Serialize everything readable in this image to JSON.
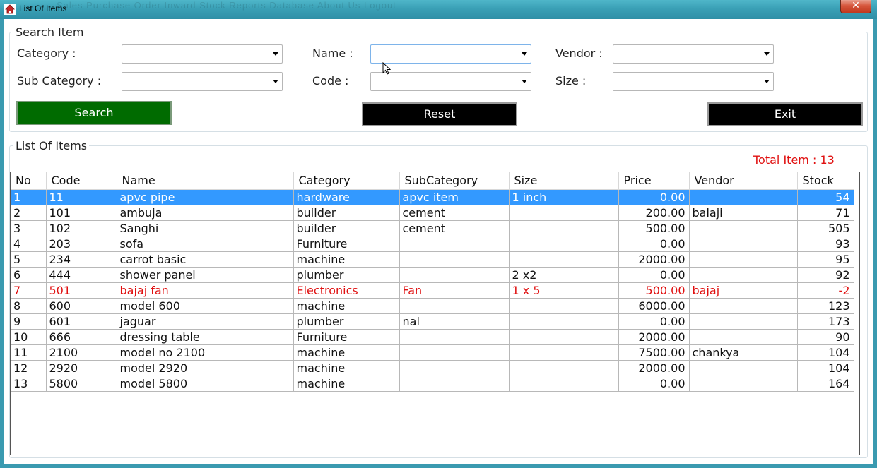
{
  "window": {
    "title": "List Of Items",
    "close_label": "✕",
    "background_menu": "Sales    Purchase Order    Inward Stock    Reports    Database    About Us    Logout"
  },
  "search": {
    "legend": "Search Item",
    "category_label": "Category :",
    "sub_category_label": "Sub Category :",
    "name_label": "Name :",
    "code_label": "Code :",
    "vendor_label": "Vendor :",
    "size_label": "Size :",
    "category_value": "",
    "sub_category_value": "",
    "name_value": "",
    "code_value": "",
    "vendor_value": "",
    "size_value": "",
    "search_button": "Search",
    "reset_button": "Reset",
    "exit_button": "Exit"
  },
  "list": {
    "legend": "List Of Items",
    "total_label": "Total Item : 13"
  },
  "table": {
    "columns": [
      "No",
      "Code",
      "Name",
      "Category",
      "SubCategory",
      "Size",
      "Price",
      "Vendor",
      "Stock"
    ],
    "rows": [
      [
        "1",
        "11",
        "apvc pipe",
        "hardware",
        "apvc item",
        "1 inch",
        "0.00",
        "",
        "54"
      ],
      [
        "2",
        "101",
        "ambuja",
        "builder",
        "cement",
        "",
        "200.00",
        "balaji",
        "71"
      ],
      [
        "3",
        "102",
        "Sanghi",
        "builder",
        "cement",
        "",
        "500.00",
        "",
        "505"
      ],
      [
        "4",
        "203",
        "sofa",
        "Furniture",
        "",
        "",
        "0.00",
        "",
        "93"
      ],
      [
        "5",
        "234",
        "carrot basic",
        "machine",
        "",
        "",
        "2000.00",
        "",
        "95"
      ],
      [
        "6",
        "444",
        "shower panel",
        "plumber",
        "",
        "2 x2",
        "0.00",
        "",
        "92"
      ],
      [
        "7",
        "501",
        "bajaj fan",
        "Electronics",
        "Fan",
        "1 x 5",
        "500.00",
        "bajaj",
        "-2"
      ],
      [
        "8",
        "600",
        "model 600",
        "machine",
        "",
        "",
        "6000.00",
        "",
        "123"
      ],
      [
        "9",
        "601",
        "jaguar",
        "plumber",
        "nal",
        "",
        "0.00",
        "",
        "173"
      ],
      [
        "10",
        "666",
        "dressing table",
        "Furniture",
        "",
        "",
        "2000.00",
        "",
        "90"
      ],
      [
        "11",
        "2100",
        "model no 2100",
        "machine",
        "",
        "",
        "7500.00",
        "chankya",
        "104"
      ],
      [
        "12",
        "2920",
        "model 2920",
        "machine",
        "",
        "",
        "2000.00",
        "",
        "104"
      ],
      [
        "13",
        "5800",
        "model 5800",
        "machine",
        "",
        "",
        "0.00",
        "",
        "164"
      ]
    ],
    "selected_row": 0,
    "alert_row": 6
  },
  "colors": {
    "selection": "#3399ff",
    "alert_text": "#e01010",
    "search_button": "#006b00",
    "titlebar": "#3aa0b6"
  }
}
